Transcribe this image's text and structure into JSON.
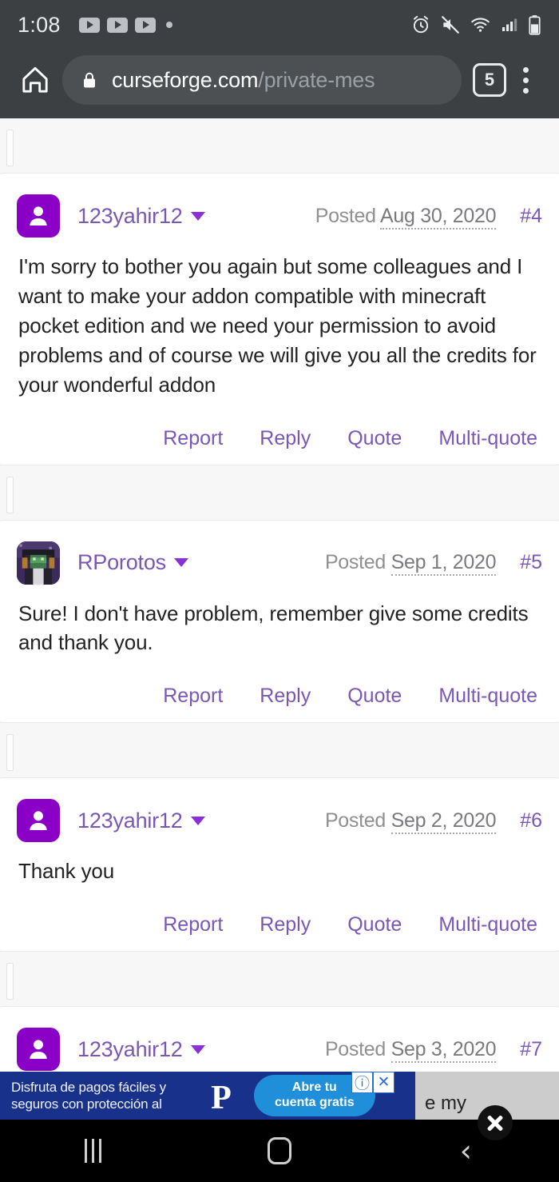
{
  "status_bar": {
    "clock": "1:08",
    "icons": [
      "youtube-play",
      "youtube-play",
      "youtube-play",
      "dot",
      "alarm",
      "mute",
      "wifi",
      "signal",
      "battery"
    ]
  },
  "browser": {
    "home_icon": "home-icon",
    "lock_icon": "lock-icon",
    "url_domain": "curseforge.com",
    "url_path": "/private-mes",
    "tab_count": "5",
    "menu_icon": "overflow-menu-icon"
  },
  "actions_labels": {
    "report": "Report",
    "reply": "Reply",
    "quote": "Quote",
    "multi_quote": "Multi-quote"
  },
  "posted_label": "Posted",
  "posts": [
    {
      "author": "123yahir12",
      "avatar_type": "default",
      "date": "Aug 30, 2020",
      "number": "#4",
      "body": "I'm sorry to bother you again but some colleagues and I want to make your addon compatible with minecraft pocket edition and we need your permission to avoid problems and of course we will give you all the credits for your wonderful addon"
    },
    {
      "author": "RPorotos",
      "avatar_type": "image",
      "date": "Sep 1, 2020",
      "number": "#5",
      "body": "Sure! I don't have problem, remember give some credits and thank you."
    },
    {
      "author": "123yahir12",
      "avatar_type": "default",
      "date": "Sep 2, 2020",
      "number": "#6",
      "body": "Thank you"
    },
    {
      "author": "123yahir12",
      "avatar_type": "default",
      "date": "Sep 3, 2020",
      "number": "#7",
      "body": "e my"
    }
  ],
  "ad": {
    "text": "Disfruta de pagos fáciles y seguros con protección al",
    "brand_icon": "paypal-icon",
    "cta_line1": "Abre tu",
    "cta_line2": "cuenta gratis",
    "info_badge": "ⓘ",
    "close_badge": "✕",
    "occluded_text": "e my"
  },
  "navigation_bar": {
    "recents": "recents-icon",
    "home": "home-icon",
    "back": "back-icon"
  },
  "colors": {
    "link_purple": "#7a57b5",
    "avatar_purple": "#8b00c7",
    "chrome_dark": "#3c4043",
    "page_bg": "#f6f6f6",
    "ad_blue": "#18328c"
  }
}
